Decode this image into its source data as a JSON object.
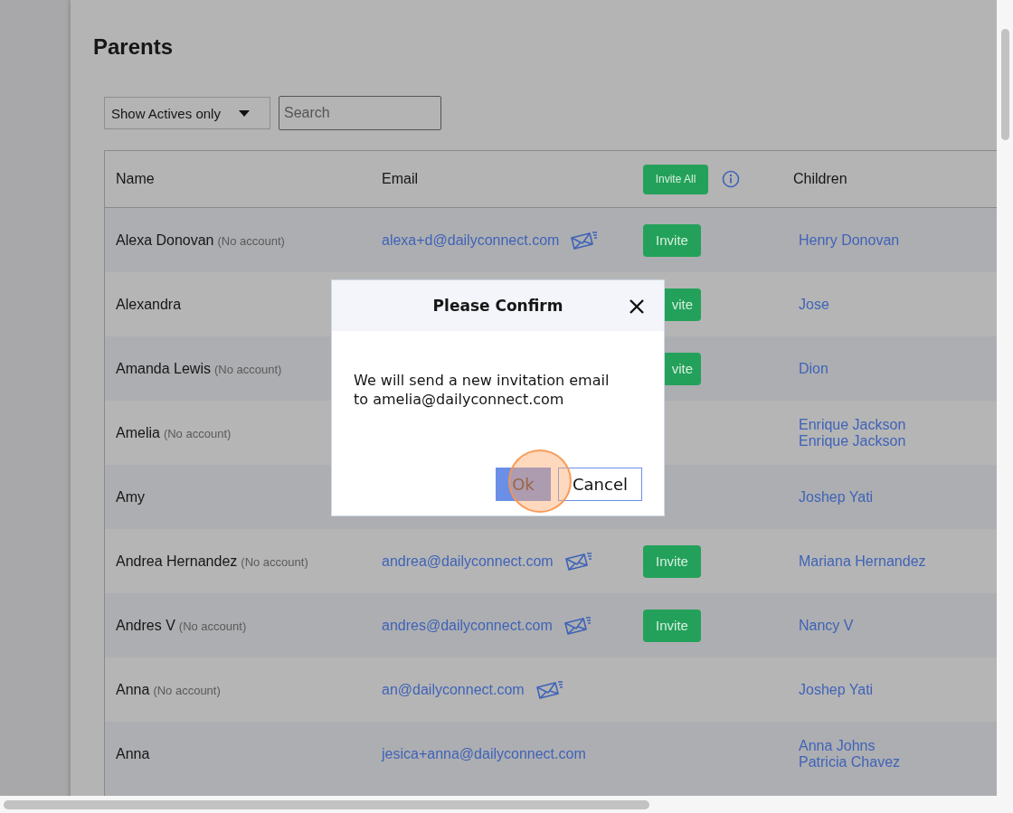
{
  "page": {
    "title": "Parents"
  },
  "filter": {
    "value": "Show Actives only"
  },
  "search": {
    "placeholder": "Search"
  },
  "table": {
    "columns": [
      "Name",
      "Email",
      "Children"
    ],
    "invite_all": "Invite All",
    "rows": [
      {
        "name": "Alexa Donovan",
        "note": "(No account)",
        "email": "alexa+d@dailyconnect.com",
        "resend_icon": true,
        "invite": "Invite",
        "children": [
          "Henry Donovan"
        ]
      },
      {
        "name": "Alexandra",
        "invite": "vite",
        "covered": true,
        "children": [
          "Jose"
        ]
      },
      {
        "name": "Amanda Lewis",
        "note": "(No account)",
        "invite": "vite",
        "covered": true,
        "children": [
          "Dion"
        ]
      },
      {
        "name": "Amelia",
        "note": "(No account)",
        "children": [
          "Enrique Jackson",
          "Enrique Jackson"
        ]
      },
      {
        "name": "Amy",
        "children": [
          "Joshep Yati"
        ]
      },
      {
        "name": "Andrea Hernandez",
        "note": "(No account)",
        "email": "andrea@dailyconnect.com",
        "resend_icon": true,
        "invite": "Invite",
        "children": [
          "Mariana Hernandez"
        ]
      },
      {
        "name": "Andres V",
        "note": "(No account)",
        "email": "andres@dailyconnect.com",
        "resend_icon": true,
        "invite": "Invite",
        "children": [
          "Nancy V"
        ]
      },
      {
        "name": "Anna",
        "note": "(No account)",
        "email": "an@dailyconnect.com",
        "resend_icon": true,
        "children": [
          "Joshep Yati"
        ]
      },
      {
        "name": "Anna",
        "email": "jesica+anna@dailyconnect.com",
        "resend_icon": false,
        "children": [
          "Anna Johns",
          "Patricia Chavez"
        ]
      }
    ]
  },
  "dialog": {
    "title": "Please Confirm",
    "message": "We will send a new invitation email to amelia@dailyconnect.com",
    "buttons": [
      {
        "label": "Ok",
        "kind": "primary"
      },
      {
        "label": "Cancel",
        "kind": "secondary"
      }
    ]
  }
}
